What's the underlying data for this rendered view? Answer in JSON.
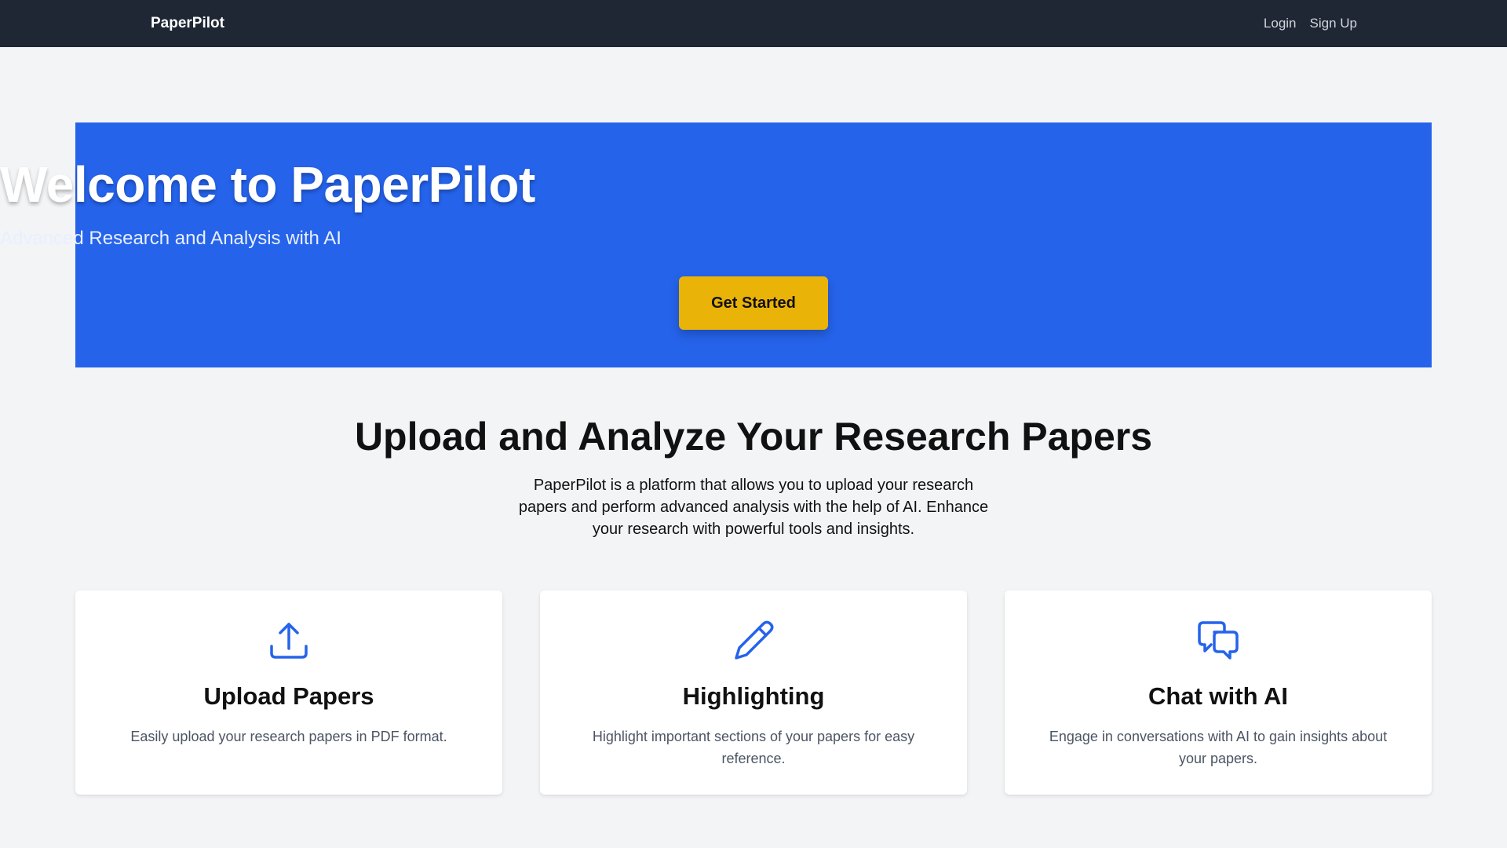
{
  "nav": {
    "brand": "PaperPilot",
    "links": [
      {
        "label": "Login"
      },
      {
        "label": "Sign Up"
      }
    ]
  },
  "hero": {
    "title": "Welcome to PaperPilot",
    "subtitle": "Advanced Research and Analysis with AI",
    "cta_label": "Get Started"
  },
  "intro": {
    "title": "Upload and Analyze Your Research Papers",
    "text": "PaperPilot is a platform that allows you to upload your research papers and perform advanced analysis with the help of AI. Enhance your research with powerful tools and insights."
  },
  "features": [
    {
      "icon": "upload-icon",
      "title": "Upload Papers",
      "description": "Easily upload your research papers in PDF format."
    },
    {
      "icon": "pencil-icon",
      "title": "Highlighting",
      "description": "Highlight important sections of your papers for easy reference."
    },
    {
      "icon": "chat-bubbles-icon",
      "title": "Chat with AI",
      "description": "Engage in conversations with AI to gain insights about your papers."
    }
  ],
  "colors": {
    "navbar_bg": "#1f2735",
    "hero_bg": "#2563eb",
    "cta_bg": "#eab308",
    "icon_accent": "#2563eb",
    "page_bg": "#f3f4f6"
  }
}
